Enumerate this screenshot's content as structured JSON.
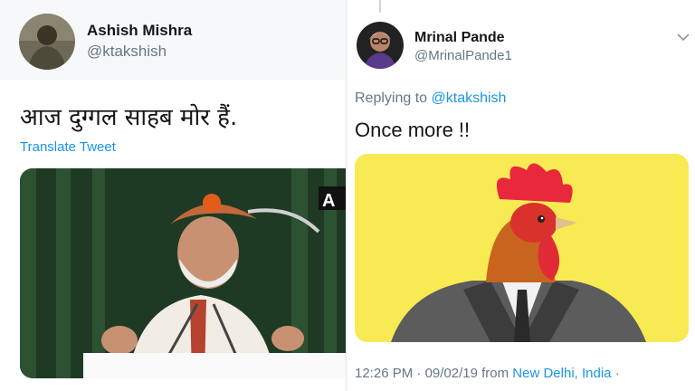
{
  "left_tweet": {
    "author_name": "Ashish Mishra",
    "author_handle": "@ktakshish",
    "text": "आज दुग्गल साहब मोर हैं.",
    "translate_label": "Translate Tweet",
    "media_watermark": "A"
  },
  "right_tweet": {
    "author_name": "Mrinal Pande",
    "author_handle": "@MrinalPande1",
    "replying_prefix": "Replying to",
    "replying_to": "@ktakshish",
    "text": "Once more !!",
    "time": "12:26 PM",
    "separator": "·",
    "date": "09/02/19",
    "from_label": "from",
    "location": "New Delhi, India",
    "trailing_dot": "·"
  },
  "colors": {
    "link": "#1b95e0",
    "secondary_text": "#657786",
    "primary_text": "#14171a",
    "rooster_background": "#f7ea52"
  },
  "icons": {
    "menu": "chevron-down-icon"
  }
}
